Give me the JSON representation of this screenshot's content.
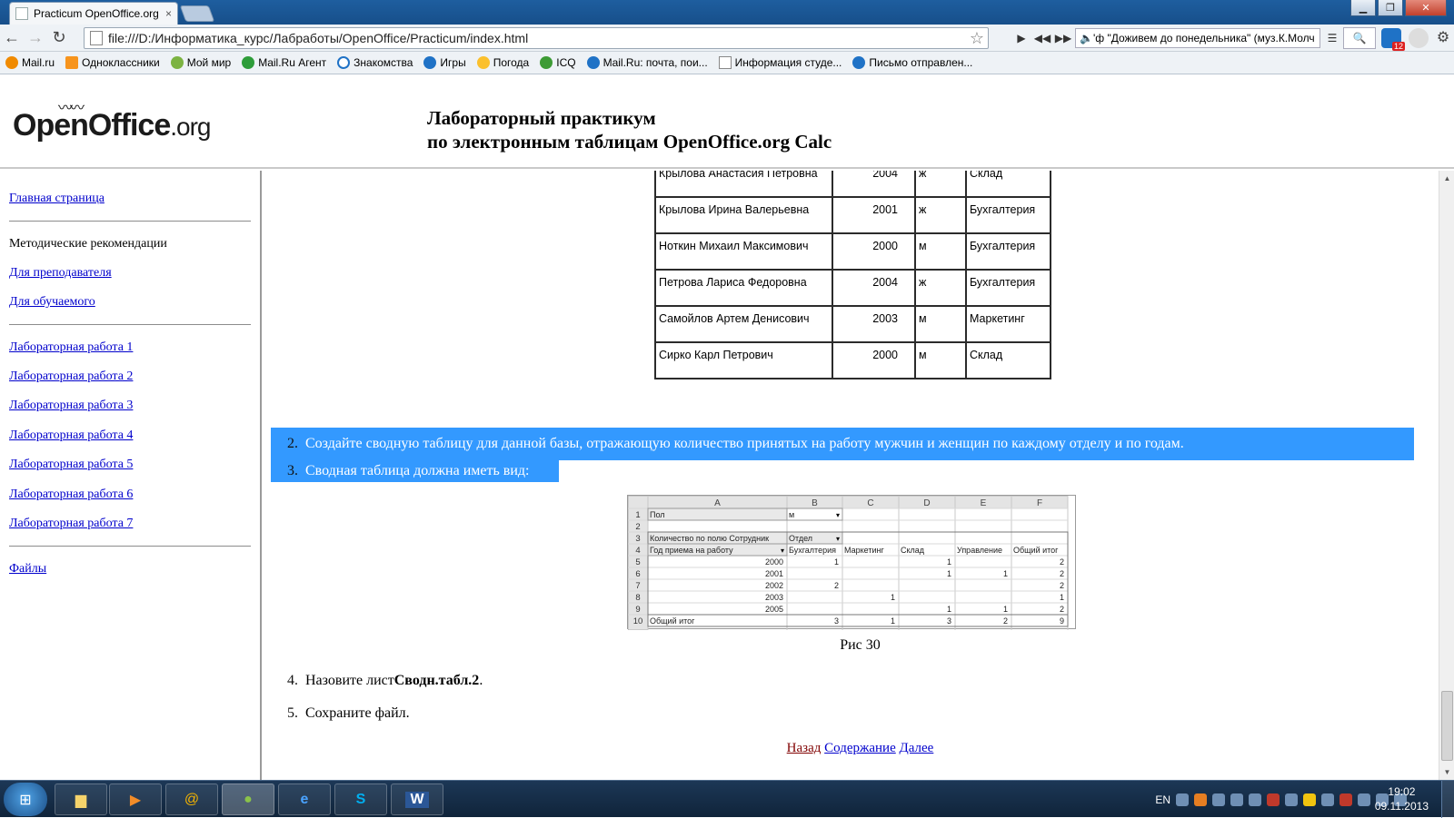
{
  "browser": {
    "tab_title": "Practicum OpenOffice.org",
    "tab_close": "×",
    "url": "file:///D:/Информатика_курс/Лабработы/OpenOffice/Practicum/index.html",
    "player_track": "'ф \"Доживем до понедельника\" (муз.К.Молч",
    "bookmarks": [
      "Mail.ru",
      "Одноклассники",
      "Мой мир",
      "Mail.Ru Агент",
      "Знакомства",
      "Игры",
      "Погода",
      "ICQ",
      "Mail.Ru: почта, пои...",
      "Информация студе...",
      "Письмо отправлен..."
    ],
    "ext_badge": "12"
  },
  "header": {
    "logo_main": "OpenOffice",
    "logo_suffix": ".org",
    "title_line1": "Лабораторный практикум",
    "title_line2": "по электронным таблицам OpenOffice.org Calc"
  },
  "nav": {
    "home": "Главная страница",
    "methodics": "Методические рекомендации",
    "for_teacher": "Для преподавателя",
    "for_student": "Для обучаемого",
    "labs": [
      "Лабораторная работа 1",
      "Лабораторная работа 2",
      "Лабораторная работа 3",
      "Лабораторная работа 4",
      "Лабораторная работа 5",
      "Лабораторная работа 6",
      "Лабораторная работа 7"
    ],
    "files": "Файлы"
  },
  "table": {
    "rows": [
      {
        "name": "Крылова Анастасия Петровна",
        "year": "2004",
        "sex": "ж",
        "dept": "Склад"
      },
      {
        "name": "Крылова Ирина Валерьевна",
        "year": "2001",
        "sex": "ж",
        "dept": "Бухгалтерия"
      },
      {
        "name": "Ноткин Михаил Максимович",
        "year": "2000",
        "sex": "м",
        "dept": "Бухгалтерия"
      },
      {
        "name": "Петрова Лариса Федоровна",
        "year": "2004",
        "sex": "ж",
        "dept": "Бухгалтерия"
      },
      {
        "name": "Самойлов Артем Денисович",
        "year": "2003",
        "sex": "м",
        "dept": "Маркетинг"
      },
      {
        "name": "Сирко Карл Петрович",
        "year": "2000",
        "sex": "м",
        "dept": "Склад"
      }
    ]
  },
  "steps": {
    "s2_num": "2.",
    "s2": "Создайте сводную таблицу для данной базы, отражающую количество принятых на работу мужчин и женщин по каждому отделу и по годам.",
    "s3_num": "3.",
    "s3": "Сводная таблица должна иметь вид:",
    "s4_num": "4.",
    "s4_pre": "Назовите лист ",
    "s4_bold": "Сводн.табл.2",
    "s4_post": ".",
    "s5_num": "5.",
    "s5": "Сохраните файл."
  },
  "pivot": {
    "col_letters": [
      "A",
      "B",
      "C",
      "D",
      "E",
      "F"
    ],
    "row_numbers": [
      "1",
      "2",
      "3",
      "4",
      "5",
      "6",
      "7",
      "8",
      "9",
      "10"
    ],
    "r1_label": "Пол",
    "r1_value": "м",
    "r3_label": "Количество по полю Сотрудник",
    "r3_field": "Отдел",
    "r4_label": "Год приема на работу",
    "headers": [
      "Бухгалтерия",
      "Маркетинг",
      "Склад",
      "Управление",
      "Общий итог"
    ],
    "rows": [
      {
        "year": "2000",
        "vals": [
          "1",
          "",
          "1",
          "",
          "2"
        ]
      },
      {
        "year": "2001",
        "vals": [
          "",
          "",
          "1",
          "1",
          "2"
        ]
      },
      {
        "year": "2002",
        "vals": [
          "2",
          "",
          "",
          "",
          "2"
        ]
      },
      {
        "year": "2003",
        "vals": [
          "",
          "1",
          "",
          "",
          "1"
        ]
      },
      {
        "year": "2005",
        "vals": [
          "",
          "",
          "1",
          "1",
          "2"
        ]
      }
    ],
    "total_label": "Общий итог",
    "totals": [
      "3",
      "1",
      "3",
      "2",
      "9"
    ]
  },
  "caption": "Рис 30",
  "pager": {
    "back": "Назад",
    "contents": "Содержание",
    "next": "Далее"
  },
  "taskbar": {
    "lang": "EN",
    "time": "19:02",
    "date": "09.11.2013"
  }
}
